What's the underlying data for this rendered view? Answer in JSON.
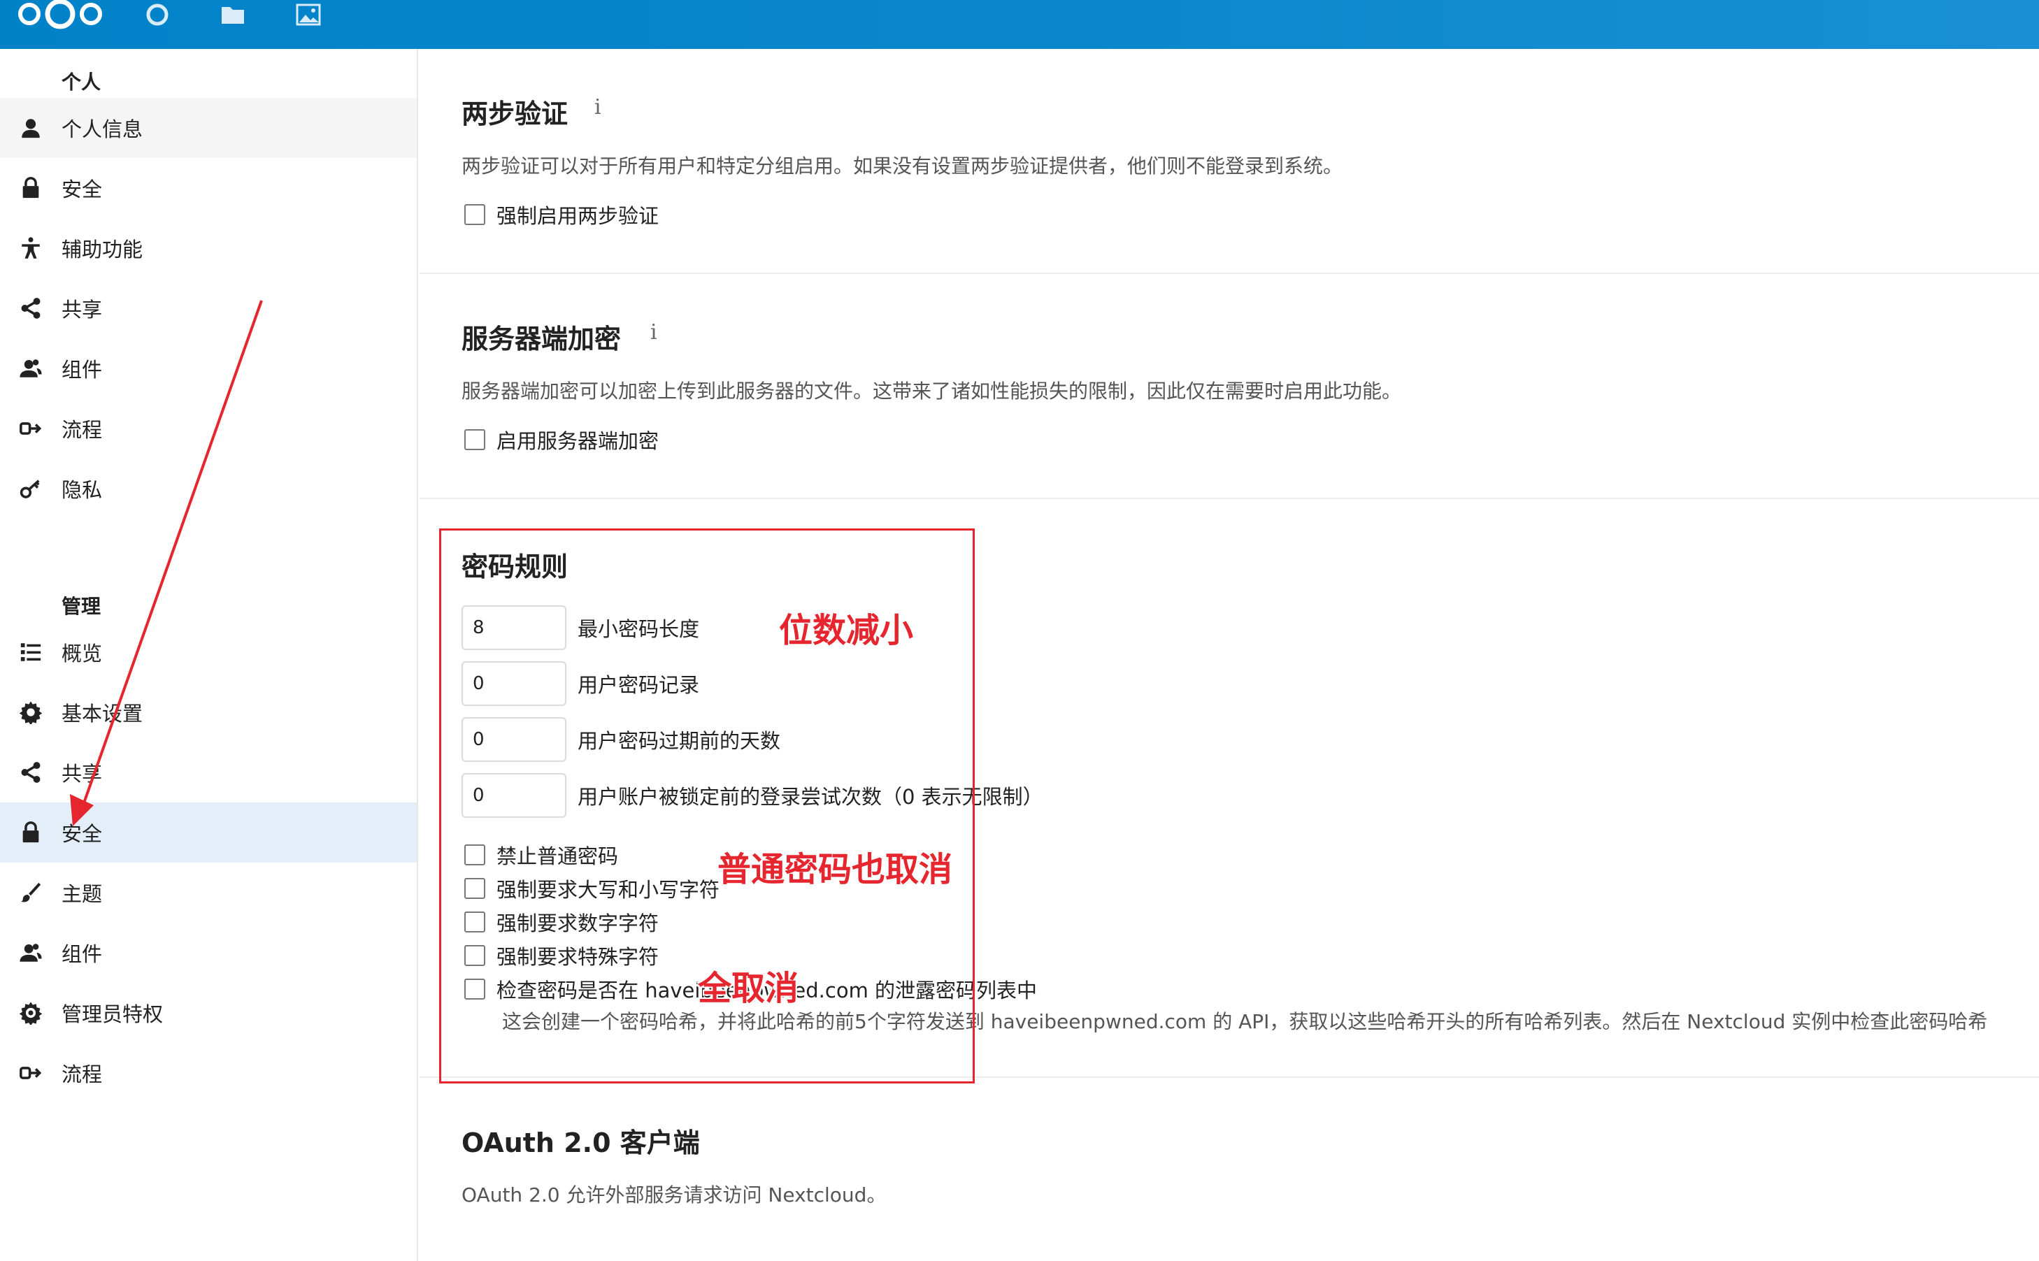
{
  "sidebar": {
    "personal_heading": "个人",
    "personal_items": [
      {
        "label": "个人信息",
        "icon": "user-icon"
      },
      {
        "label": "安全",
        "icon": "lock-icon"
      },
      {
        "label": "辅助功能",
        "icon": "accessibility-icon"
      },
      {
        "label": "共享",
        "icon": "share-icon"
      },
      {
        "label": "组件",
        "icon": "group-icon"
      },
      {
        "label": "流程",
        "icon": "flow-icon"
      },
      {
        "label": "隐私",
        "icon": "key-icon"
      }
    ],
    "admin_heading": "管理",
    "admin_items": [
      {
        "label": "概览",
        "icon": "list-icon"
      },
      {
        "label": "基本设置",
        "icon": "gear-icon"
      },
      {
        "label": "共享",
        "icon": "share-icon"
      },
      {
        "label": "安全",
        "icon": "lock-icon"
      },
      {
        "label": "主题",
        "icon": "brush-icon"
      },
      {
        "label": "组件",
        "icon": "group-icon"
      },
      {
        "label": "管理员特权",
        "icon": "gear-admin-icon"
      },
      {
        "label": "流程",
        "icon": "flow-icon"
      }
    ]
  },
  "two_factor": {
    "title": "两步验证",
    "info": "i",
    "description": "两步验证可以对于所有用户和特定分组启用。如果没有设置两步验证提供者，他们则不能登录到系统。",
    "checkbox": "强制启用两步验证"
  },
  "server_encryption": {
    "title": "服务器端加密",
    "info": "i",
    "description": "服务器端加密可以加密上传到此服务器的文件。这带来了诸如性能损失的限制，因此仅在需要时启用此功能。",
    "checkbox": "启用服务器端加密"
  },
  "password_policy": {
    "title": "密码规则",
    "fields": [
      {
        "value": "8",
        "label": "最小密码长度"
      },
      {
        "value": "0",
        "label": "用户密码记录"
      },
      {
        "value": "0",
        "label": "用户密码过期前的天数"
      },
      {
        "value": "0",
        "label": "用户账户被锁定前的登录尝试次数（0 表示无限制）"
      }
    ],
    "checkboxes": [
      "禁止普通密码",
      "强制要求大写和小写字符",
      "强制要求数字字符",
      "强制要求特殊字符",
      "检查密码是否在 haveibeenpwned.com 的泄露密码列表中"
    ],
    "hibp_note": "这会创建一个密码哈希，并将此哈希的前5个字符发送到 haveibeenpwned.com 的 API，获取以这些哈希开头的所有哈希列表。然后在 Nextcloud 实例中检查此密码哈希"
  },
  "oauth": {
    "title": "OAuth 2.0 客户端",
    "description": "OAuth 2.0 允许外部服务请求访问 Nextcloud。"
  },
  "annotations": {
    "reduce_digits": "位数减小",
    "common_cancel": "普通密码也取消",
    "all_cancel": "全取消"
  },
  "colors": {
    "header": "#0082c9",
    "annotation": "#e5262e",
    "active_nav": "#e3eef8"
  }
}
